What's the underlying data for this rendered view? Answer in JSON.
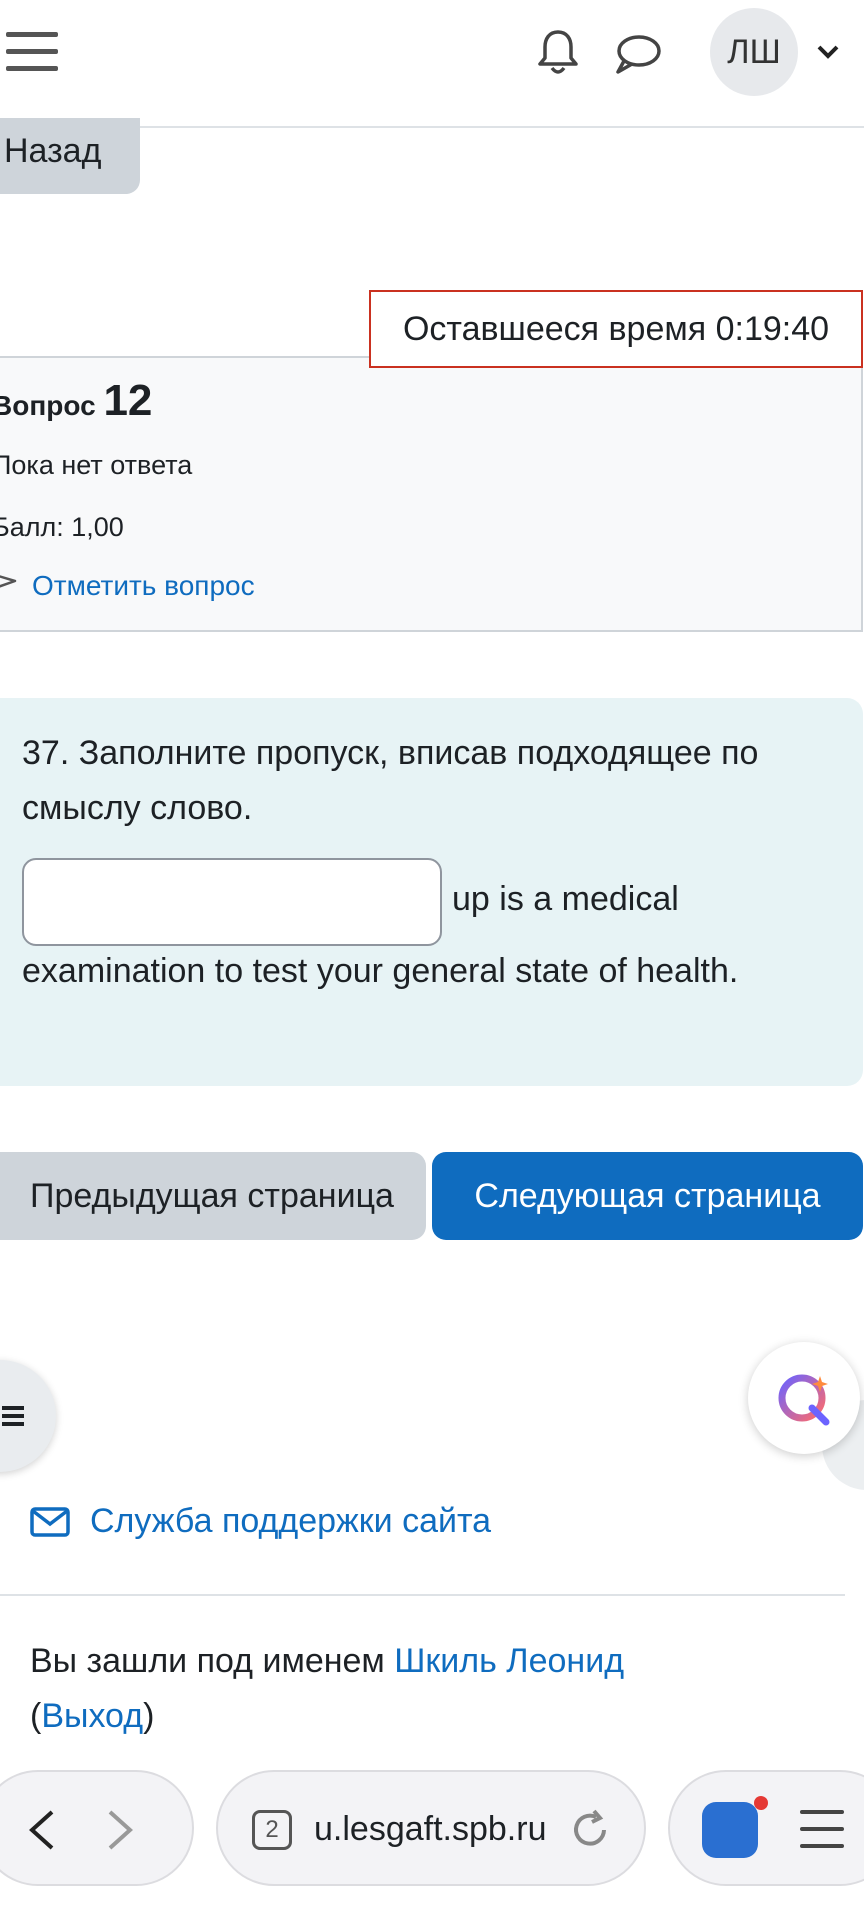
{
  "header": {
    "avatar_initials": "ЛШ"
  },
  "back_button": "Назад",
  "timer": {
    "text": "Оставшееся время 0:19:40"
  },
  "question_info": {
    "label": "Вопрос",
    "number": "12",
    "status": "Пока нет ответа",
    "grade": "Балл: 1,00",
    "flag_label": "Отметить вопрос"
  },
  "question": {
    "text": "37. Заполните пропуск, вписав подходящее по смыслу слово.",
    "answer_value": "",
    "after_input": "up is a medical",
    "line2": "examination to test your general state of health."
  },
  "navigation": {
    "prev_label": "Предыдущая страница",
    "next_label": "Следующая страница"
  },
  "footer": {
    "support_label": "Служба поддержки сайта",
    "logged_in_prefix": "Вы зашли под именем",
    "user_name": "Шкиль Леонид",
    "logout_open": "(",
    "logout_label": "Выход",
    "logout_close": ")"
  },
  "browser": {
    "tab_count": "2",
    "url": "u.lesgaft.spb.ru"
  },
  "colors": {
    "primary": "#0f6cbf",
    "timer_border": "#ca3120",
    "content_bg": "#e7f3f5"
  }
}
